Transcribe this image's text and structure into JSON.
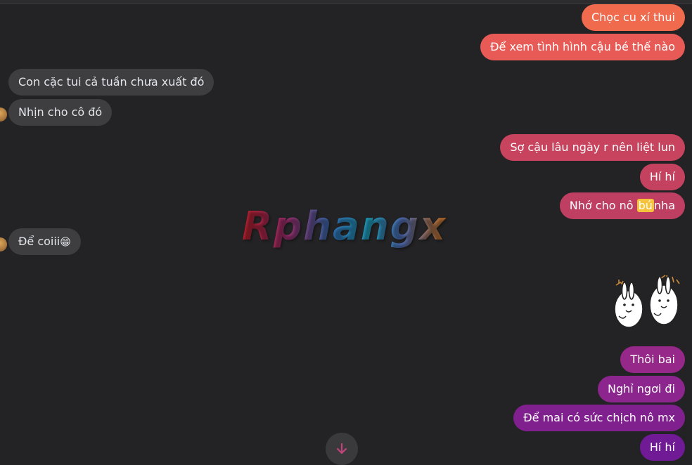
{
  "colors": {
    "background": "#232325",
    "incoming_bubble": "#3e3e41",
    "outgoing_gradient": [
      "#f06a4e",
      "#d54a63",
      "#b73a72",
      "#8a2a8e",
      "#6d1a96"
    ],
    "highlight": "#f6c13b",
    "scroll_arrow": "#c0447a"
  },
  "watermark": {
    "text": "Rphangx"
  },
  "messages": [
    {
      "side": "outgoing",
      "text": "Chọc cu xí thui"
    },
    {
      "side": "outgoing",
      "text": "Để xem tình hình cậu bé thế nào"
    },
    {
      "side": "incoming",
      "text": "Con cặc tui cả tuần chưa xuất đó"
    },
    {
      "side": "incoming",
      "text": "Nhịn cho cô đó",
      "avatar": true
    },
    {
      "side": "outgoing",
      "text": "Sợ cậu lâu ngày r nên liệt lun"
    },
    {
      "side": "outgoing",
      "text": "Hí hí"
    },
    {
      "side": "outgoing",
      "text_before": "Nhớ cho nô ",
      "highlight": "bú",
      "text_after": "nha"
    },
    {
      "side": "incoming",
      "text": "Để coiii",
      "emoji": "😁",
      "avatar": true
    },
    {
      "side": "outgoing",
      "type": "sticker",
      "icon": "bunny-sticker-icon"
    },
    {
      "side": "outgoing",
      "text": "Thôi bai"
    },
    {
      "side": "outgoing",
      "text": "Nghỉ ngơi đi"
    },
    {
      "side": "outgoing",
      "text": "Để mai có sức chịch nô mx"
    },
    {
      "side": "outgoing",
      "text": "Hí hí"
    }
  ],
  "scroll_button": {
    "icon": "arrow-down-icon"
  }
}
